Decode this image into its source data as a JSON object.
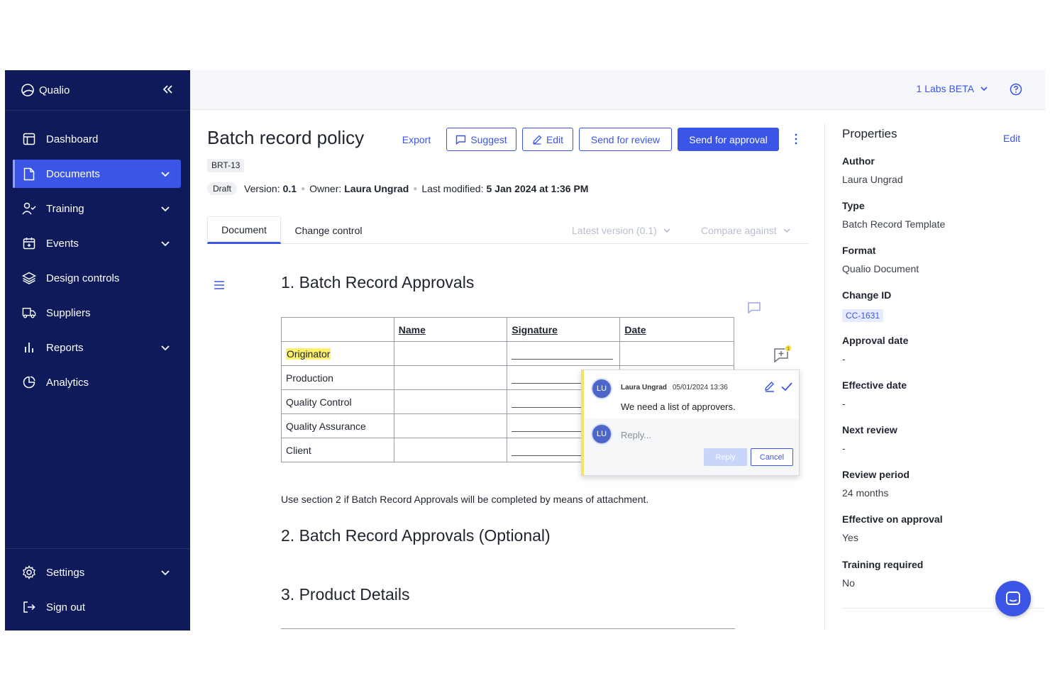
{
  "sidebar": {
    "brand": "Qualio",
    "items": [
      {
        "label": "Dashboard"
      },
      {
        "label": "Documents"
      },
      {
        "label": "Training"
      },
      {
        "label": "Events"
      },
      {
        "label": "Design controls"
      },
      {
        "label": "Suppliers"
      },
      {
        "label": "Reports"
      },
      {
        "label": "Analytics"
      }
    ],
    "footer": [
      {
        "label": "Settings"
      },
      {
        "label": "Sign out"
      }
    ]
  },
  "topbar": {
    "labs_label": "1 Labs BETA"
  },
  "document": {
    "title": "Batch record policy",
    "code": "BRT-13",
    "status": "Draft",
    "version_label": "Version:",
    "version": "0.1",
    "owner_label": "Owner:",
    "owner": "Laura Ungrad",
    "modified_label": "Last modified:",
    "modified": "5 Jan 2024 at 1:36 PM"
  },
  "toolbar": {
    "export": "Export",
    "suggest": "Suggest",
    "edit": "Edit",
    "send_review": "Send for review",
    "send_approval": "Send for approval"
  },
  "tabs": {
    "document": "Document",
    "change_control": "Change control",
    "version_select": "Latest version (0.1)",
    "compare_select": "Compare against"
  },
  "content": {
    "section1": "1. Batch Record Approvals",
    "table": {
      "headers": [
        "",
        "Name",
        "Signature",
        "Date"
      ],
      "rows": [
        "Originator",
        "Production",
        "Quality Control",
        "Quality Assurance",
        "Client"
      ]
    },
    "note": "Use section 2 if Batch Record Approvals will be completed by means of attachment.",
    "section2": "2. Batch Record Approvals (Optional)",
    "section3": "3. Product Details"
  },
  "comment": {
    "initials": "LU",
    "author": "Laura Ungrad",
    "date": "05/01/2024 13:36",
    "body": "We need a list of approvers.",
    "badge": "1",
    "reply_placeholder": "Reply...",
    "reply_button": "Reply",
    "cancel_button": "Cancel"
  },
  "properties": {
    "title": "Properties",
    "edit": "Edit",
    "fields": [
      {
        "label": "Author",
        "value": "Laura Ungrad"
      },
      {
        "label": "Type",
        "value": "Batch Record Template"
      },
      {
        "label": "Format",
        "value": "Qualio Document"
      },
      {
        "label": "Change ID",
        "value": "CC-1631"
      },
      {
        "label": "Approval date",
        "value": "-"
      },
      {
        "label": "Effective date",
        "value": "-"
      },
      {
        "label": "Next review",
        "value": "-"
      },
      {
        "label": "Review period",
        "value": "24 months"
      },
      {
        "label": "Effective on approval",
        "value": "Yes"
      },
      {
        "label": "Training required",
        "value": "No"
      }
    ]
  },
  "colors": {
    "sidebar_bg": "#0e1a59",
    "accent": "#3b55e6",
    "highlight": "#fbef6c"
  }
}
